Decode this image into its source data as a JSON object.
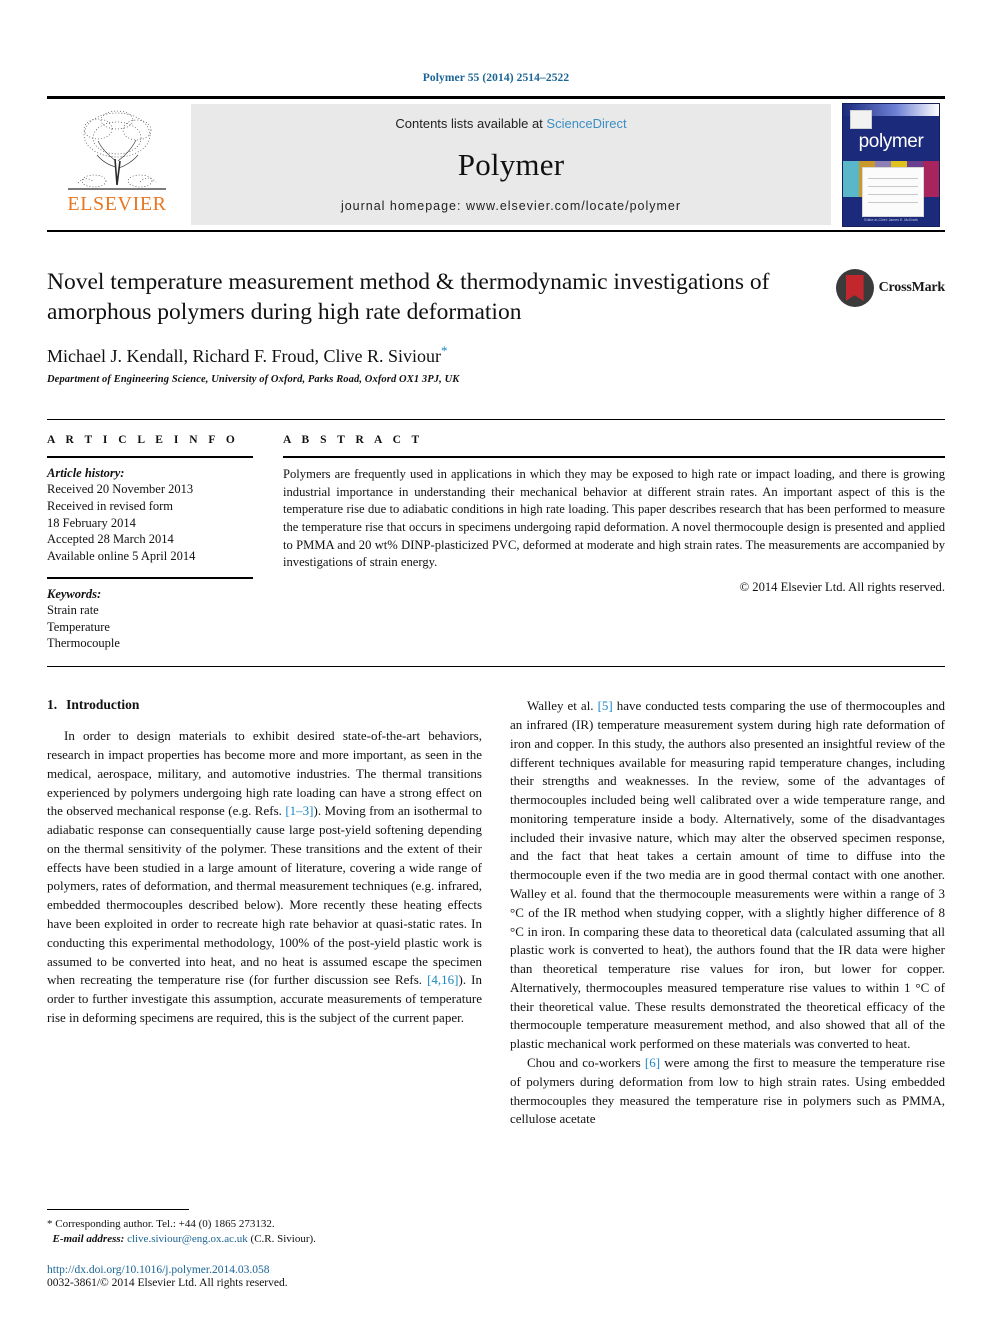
{
  "running_head": "Polymer 55 (2014) 2514–2522",
  "masthead": {
    "publisher_name": "ELSEVIER",
    "contents_prefix": "Contents lists available at ",
    "contents_link": "ScienceDirect",
    "journal_name": "Polymer",
    "homepage": "journal homepage: www.elsevier.com/locate/polymer",
    "cover_title": "polymer",
    "cover_footer": "Editor-in-Chief: James E. McGrath"
  },
  "article": {
    "title": "Novel temperature measurement method & thermodynamic investigations of amorphous polymers during high rate deformation",
    "authors": "Michael J. Kendall, Richard F. Froud, Clive R. Siviour",
    "corresponding_marker": "*",
    "affiliation": "Department of Engineering Science, University of Oxford, Parks Road, Oxford OX1 3PJ, UK",
    "crossmark_label": "CrossMark"
  },
  "article_info": {
    "heading": "A R T I C L E  I N F O",
    "history_label": "Article history:",
    "history": [
      "Received 20 November 2013",
      "Received in revised form",
      "18 February 2014",
      "Accepted 28 March 2014",
      "Available online 5 April 2014"
    ],
    "keywords_label": "Keywords:",
    "keywords": [
      "Strain rate",
      "Temperature",
      "Thermocouple"
    ]
  },
  "abstract": {
    "heading": "A B S T R A C T",
    "body": "Polymers are frequently used in applications in which they may be exposed to high rate or impact loading, and there is growing industrial importance in understanding their mechanical behavior at different strain rates. An important aspect of this is the temperature rise due to adiabatic conditions in high rate loading. This paper describes research that has been performed to measure the temperature rise that occurs in specimens undergoing rapid deformation. A novel thermocouple design is presented and applied to PMMA and 20 wt% DINP-plasticized PVC, deformed at moderate and high strain rates. The measurements are accompanied by investigations of strain energy.",
    "copyright": "© 2014 Elsevier Ltd. All rights reserved."
  },
  "section": {
    "number": "1.",
    "title": "Introduction"
  },
  "left_column": {
    "p1_a": "In order to design materials to exhibit desired state-of-the-art behaviors, research in impact properties has become more and more important, as seen in the medical, aerospace, military, and automotive industries. The thermal transitions experienced by polymers undergoing high rate loading can have a strong effect on the observed mechanical response (e.g. Refs. ",
    "p1_ref1": "[1–3]",
    "p1_b": "). Moving from an isothermal to adiabatic response can consequentially cause large post-yield softening depending on the thermal sensitivity of the polymer. These transitions and the extent of their effects have been studied in a large amount of literature, covering a wide range of polymers, rates of deformation, and thermal measurement techniques (e.g. infrared, embedded thermocouples described below). More recently these heating effects have been exploited in order to recreate high rate behavior at quasi-static rates. In conducting this experimental methodology, 100% of the post-yield plastic work is assumed to be converted into heat, and no heat is assumed escape the specimen when recreating the temperature rise (for further discussion see Refs. ",
    "p1_ref2": "[4,16]",
    "p1_c": "). In order to further investigate this assumption, accurate measurements of temperature rise in deforming specimens are required, this is the subject of the current paper."
  },
  "right_column": {
    "p1_a": "Walley et al. ",
    "p1_ref": "[5]",
    "p1_b": " have conducted tests comparing the use of thermocouples and an infrared (IR) temperature measurement system during high rate deformation of iron and copper. In this study, the authors also presented an insightful review of the different techniques available for measuring rapid temperature changes, including their strengths and weaknesses. In the review, some of the advantages of thermocouples included being well calibrated over a wide temperature range, and monitoring temperature inside a body. Alternatively, some of the disadvantages included their invasive nature, which may alter the observed specimen response, and the fact that heat takes a certain amount of time to diffuse into the thermocouple even if the two media are in good thermal contact with one another. Walley et al. found that the thermocouple measurements were within a range of 3 °C of the IR method when studying copper, with a slightly higher difference of 8 °C in iron. In comparing these data to theoretical data (calculated assuming that all plastic work is converted to heat), the authors found that the IR data were higher than theoretical temperature rise values for iron, but lower for copper. Alternatively, thermocouples measured temperature rise values to within 1 °C of their theoretical value. These results demonstrated the theoretical efficacy of the thermocouple temperature measurement method, and also showed that all of the plastic mechanical work performed on these materials was converted to heat.",
    "p2_a": "Chou and co-workers ",
    "p2_ref": "[6]",
    "p2_b": " were among the first to measure the temperature rise of polymers during deformation from low to high strain rates. Using embedded thermocouples they measured the temperature rise in polymers such as PMMA, cellulose acetate"
  },
  "footnotes": {
    "corresponding": "* Corresponding author. Tel.: +44 (0) 1865 273132.",
    "email_label": "E-mail address:",
    "email": "clive.siviour@eng.ox.ac.uk",
    "email_suffix": " (C.R. Siviour).",
    "doi": "http://dx.doi.org/10.1016/j.polymer.2014.03.058",
    "issn": "0032-3861/© 2014 Elsevier Ltd. All rights reserved."
  },
  "colors": {
    "link": "#1a87c4",
    "running_head": "#1a6496",
    "elsevier_orange": "#E87722",
    "cover_navy": "#1b2a7a"
  }
}
